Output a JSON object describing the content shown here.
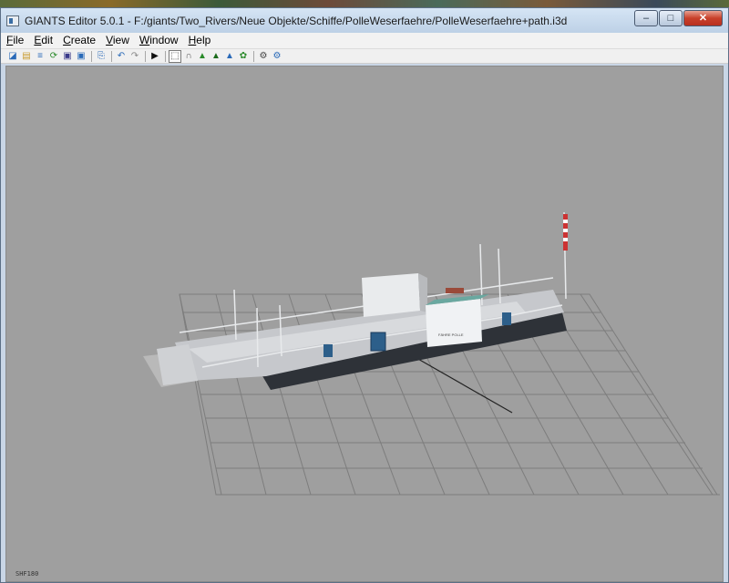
{
  "window": {
    "title": "GIANTS Editor 5.0.1 - F:/giants/Two_Rivers/Neue Objekte/Schiffe/PolleWeserfaehre/PolleWeserfaehre+path.i3d",
    "controls": {
      "minimize": "–",
      "maximize": "□",
      "close": "✕"
    }
  },
  "menu": {
    "items": [
      "File",
      "Edit",
      "Create",
      "View",
      "Window",
      "Help"
    ]
  },
  "toolbar": {
    "buttons": [
      {
        "icon": "new-file-icon",
        "glyph": "◪",
        "color": "#2a6ab8"
      },
      {
        "icon": "open-folder-icon",
        "glyph": "▤",
        "color": "#c99a2a"
      },
      {
        "icon": "import-icon",
        "glyph": "≡",
        "color": "#2a6ab8"
      },
      {
        "icon": "refresh-icon",
        "glyph": "⟳",
        "color": "#2a8a2a"
      },
      {
        "icon": "save-icon",
        "glyph": "▣",
        "color": "#3a3a8a"
      },
      {
        "icon": "save-all-icon",
        "glyph": "▣",
        "color": "#2a6ab8"
      },
      {
        "icon": "copy-icon",
        "glyph": "⎘",
        "color": "#2a6ab8"
      },
      {
        "icon": "undo-icon",
        "glyph": "↶",
        "color": "#2a6ab8"
      },
      {
        "icon": "redo-icon",
        "glyph": "↷",
        "color": "#888888"
      },
      {
        "icon": "play-icon",
        "glyph": "▶",
        "color": "#111111"
      },
      {
        "icon": "select-tool-icon",
        "glyph": "⬚",
        "color": "#222222",
        "active": true
      },
      {
        "icon": "magnet-icon",
        "glyph": "∩",
        "color": "#555555"
      },
      {
        "icon": "terrain-paint-icon",
        "glyph": "▲",
        "color": "#2a8a2a"
      },
      {
        "icon": "terrain-sculpt-icon",
        "glyph": "▲",
        "color": "#1a6a1a"
      },
      {
        "icon": "terrain-height-icon",
        "glyph": "▲",
        "color": "#2a6ab8"
      },
      {
        "icon": "foliage-icon",
        "glyph": "✿",
        "color": "#2a8a2a"
      },
      {
        "icon": "settings-gear-icon",
        "glyph": "⚙",
        "color": "#444444"
      },
      {
        "icon": "settings-gear-2-icon",
        "glyph": "⚙",
        "color": "#2a6ab8"
      }
    ]
  },
  "viewport": {
    "status_text": "SHF180",
    "background_color": "#9f9f9f",
    "scene_object": "PolleWeserfaehre",
    "cabin_label": "FÄHRE POLLE"
  }
}
